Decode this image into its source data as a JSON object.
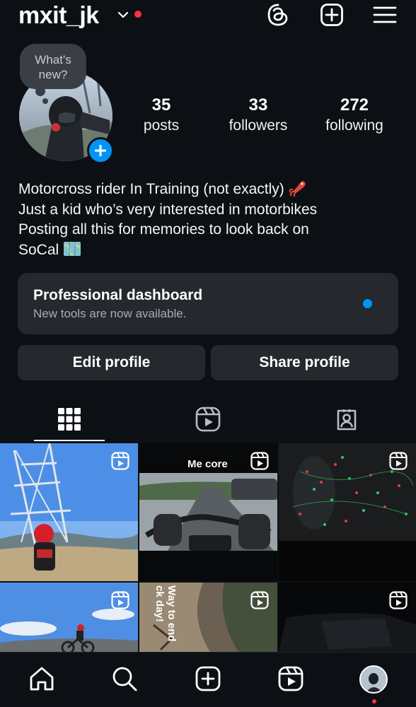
{
  "header": {
    "username": "mxit_jk",
    "icons": [
      "chevron-down-icon",
      "threads-icon",
      "create-plus-icon",
      "menu-icon"
    ],
    "notification_color": "#ff3040"
  },
  "profile": {
    "note": "What's new?",
    "stats": [
      {
        "value": "35",
        "label": "posts"
      },
      {
        "value": "33",
        "label": "followers"
      },
      {
        "value": "272",
        "label": "following"
      }
    ],
    "bio": [
      "Motorcross rider In Training (not exactly)",
      "Just a kid who’s very interested in motorbikes",
      "Posting all this for memories to look back on",
      "SoCal"
    ],
    "bio_emojis": [
      "squid-emoji",
      "map-emoji"
    ]
  },
  "dashboard": {
    "title": "Professional dashboard",
    "subtitle": "New tools are now available."
  },
  "actions": {
    "edit": "Edit profile",
    "share": "Share profile"
  },
  "tabs": [
    "grid-icon",
    "reels-icon",
    "tagged-icon"
  ],
  "grid": [
    {
      "caption": "",
      "scene": "rider in red helmet under power tower, blue sky"
    },
    {
      "caption": "Me core",
      "scene": "first-person handlebars on street"
    },
    {
      "caption": "",
      "scene": "bike with red and green string lights at night"
    },
    {
      "caption": "",
      "scene": "dirt bike rider on hill, blue sky"
    },
    {
      "caption": "Way to end ck day!",
      "scene": "dirt trail wall"
    },
    {
      "caption": "",
      "scene": "dark close-up of bike"
    }
  ],
  "nav": [
    "home-icon",
    "search-icon",
    "create-icon",
    "reels-icon",
    "profile-avatar"
  ],
  "colors": {
    "background": "#0c1014",
    "card": "#25292e",
    "accent": "#0095f6"
  }
}
